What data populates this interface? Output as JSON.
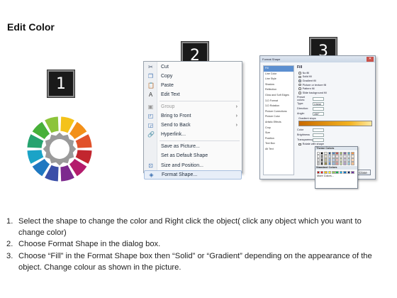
{
  "page": {
    "title": "Edit Color"
  },
  "badges": [
    "1",
    "2",
    "3"
  ],
  "wheel": {
    "segment_colors": [
      "#f4c21a",
      "#f39019",
      "#e1522a",
      "#c2262f",
      "#b41b6c",
      "#7d2a8e",
      "#3a4fa8",
      "#1f78c1",
      "#1ba3c7",
      "#26a36f",
      "#47b039",
      "#8cc43a"
    ],
    "hub_color": "#9a9a9a"
  },
  "context_menu": {
    "items": [
      {
        "label": "Cut",
        "icon": "scissors-icon",
        "glyph": "✂",
        "color": "#4a5a72"
      },
      {
        "label": "Copy",
        "icon": "copy-icon",
        "glyph": "❐",
        "color": "#3b6fb0"
      },
      {
        "label": "Paste",
        "icon": "paste-icon",
        "glyph": "📋",
        "color": "#b58a3a"
      },
      {
        "label": "Edit Text",
        "icon": "edit-text-icon",
        "glyph": "A",
        "color": "#333"
      },
      {
        "label": "Group",
        "icon": "group-icon",
        "glyph": "▣",
        "color": "#999",
        "disabled": true,
        "submenu": true
      },
      {
        "label": "Bring to Front",
        "icon": "bring-front-icon",
        "glyph": "◰",
        "color": "#3b6fb0",
        "submenu": true
      },
      {
        "label": "Send to Back",
        "icon": "send-back-icon",
        "glyph": "◲",
        "color": "#3b6fb0",
        "submenu": true
      },
      {
        "label": "Hyperlink...",
        "icon": "hyperlink-icon",
        "glyph": "🔗",
        "color": "#3b6fb0"
      },
      {
        "label": "Save as Picture...",
        "icon": "none",
        "glyph": "",
        "color": "#333"
      },
      {
        "label": "Set as Default Shape",
        "icon": "none",
        "glyph": "",
        "color": "#333"
      },
      {
        "label": "Size and Position...",
        "icon": "size-position-icon",
        "glyph": "⊡",
        "color": "#3b6fb0"
      },
      {
        "label": "Format Shape...",
        "icon": "format-shape-icon",
        "glyph": "◈",
        "color": "#3b6fb0",
        "active": true
      }
    ]
  },
  "format_dialog": {
    "title": "Format Shape",
    "close_glyph": "✕",
    "nav": [
      "Fill",
      "Line Color",
      "Line Style",
      "Shadow",
      "Reflection",
      "Glow and Soft Edges",
      "3-D Format",
      "3-D Rotation",
      "Picture Corrections",
      "Picture Color",
      "Artistic Effects",
      "Crop",
      "Size",
      "Position",
      "Text Box",
      "Alt Text"
    ],
    "panel": {
      "title": "Fill",
      "options": [
        {
          "label": "No fill",
          "on": false
        },
        {
          "label": "Solid fill",
          "on": false
        },
        {
          "label": "Gradient fill",
          "on": true
        },
        {
          "label": "Picture or texture fill",
          "on": false
        },
        {
          "label": "Pattern fill",
          "on": false
        },
        {
          "label": "Slide background fill",
          "on": false
        }
      ],
      "fields": [
        "Preset colors:",
        "Type:",
        "Direction:",
        "Angle:"
      ],
      "field_values": [
        "",
        "Linear",
        "",
        "280°"
      ],
      "gradient_stops_label": "Gradient stops",
      "lower_fields": [
        "Color",
        "Brightness",
        "Transparency"
      ],
      "rotate_label": "Rotate with shape"
    },
    "close_button": "Close"
  },
  "color_popup": {
    "theme_label": "Theme Colors",
    "theme_swatches": [
      "#ffffff",
      "#000000",
      "#eeece1",
      "#1f497d",
      "#4f81bd",
      "#c0504d",
      "#9bbb59",
      "#8064a2",
      "#4bacc6",
      "#f79646",
      "#f2f2f2",
      "#7f7f7f",
      "#ddd9c3",
      "#c6d9f0",
      "#dbe5f1",
      "#f2dcdb",
      "#ebf1dd",
      "#e5e0ec",
      "#dbeef3",
      "#fdeada",
      "#d8d8d8",
      "#595959",
      "#c4bd97",
      "#8db3e2",
      "#b8cce4",
      "#e5b9b7",
      "#d7e3bc",
      "#ccc1d9",
      "#b7dde8",
      "#fbd5b5",
      "#bfbfbf",
      "#3f3f3f",
      "#938953",
      "#548dd4",
      "#95b3d7",
      "#d99694",
      "#c3d69b",
      "#b2a2c7",
      "#92cddc",
      "#fac08f"
    ],
    "standard_label": "Standard Colors",
    "standard_swatches": [
      "#c00000",
      "#ff0000",
      "#ffc000",
      "#ffff00",
      "#92d050",
      "#00b050",
      "#00b0f0",
      "#0070c0",
      "#002060",
      "#7030a0"
    ],
    "more_label": "More Colors..."
  },
  "instructions": [
    {
      "num": "1.",
      "text": "Select the shape to change the color and Right click the object( click any object which you want to change color)"
    },
    {
      "num": "2.",
      "text": "Choose Format Shape in the dialog box."
    },
    {
      "num": "3.",
      "text": "Choose “Fill” in the Format Shape box then “Solid” or “Gradient” depending on the appearance of the object. Change colour as shown in the picture."
    }
  ]
}
